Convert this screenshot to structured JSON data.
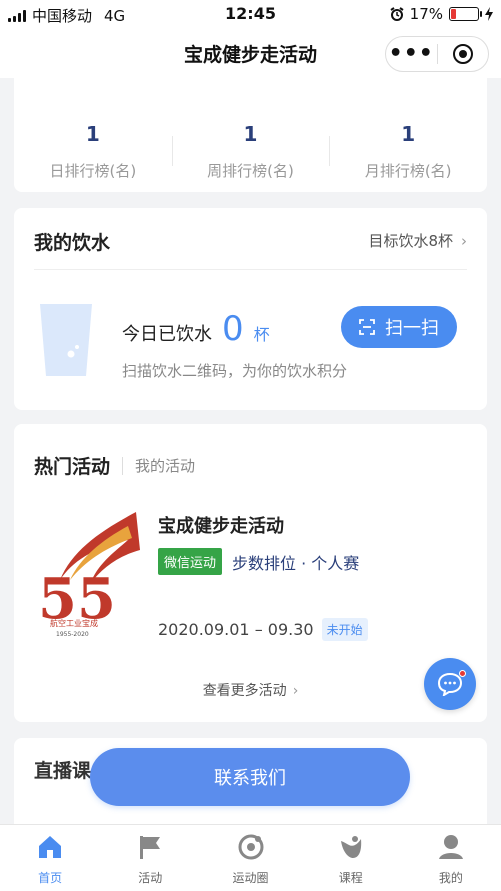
{
  "status_bar": {
    "carrier": "中国移动",
    "network": "4G",
    "time": "12:45",
    "battery": "17%",
    "battery_level": 0.17
  },
  "nav": {
    "title": "宝成健步走活动",
    "more_icon": "more-dots-icon",
    "close_icon": "target-circle-icon"
  },
  "ranking": {
    "items": [
      {
        "value": "1",
        "label": "日排行榜(名)"
      },
      {
        "value": "1",
        "label": "周排行榜(名)"
      },
      {
        "value": "1",
        "label": "月排行榜(名)"
      }
    ]
  },
  "water": {
    "title": "我的饮水",
    "goal": "目标饮水8杯",
    "today_label": "今日已饮水",
    "today_count": "0",
    "unit": "杯",
    "hint": "扫描饮水二维码，为你的饮水积分",
    "scan_label": "扫一扫"
  },
  "activities": {
    "tab_hot": "热门活动",
    "tab_mine": "我的活动",
    "item": {
      "name": "宝成健步走活动",
      "source_tag": "微信运动",
      "type": "步数排位 · 个人赛",
      "date": "2020.09.01 – 09.30",
      "status": "未开始",
      "logo_text": "航空工业宝成",
      "logo_years": "1955-2020"
    },
    "more_label": "查看更多活动"
  },
  "live": {
    "title": "直播课"
  },
  "contact_label": "联系我们",
  "tabbar": {
    "items": [
      {
        "label": "首页",
        "icon": "home-icon",
        "active": true
      },
      {
        "label": "活动",
        "icon": "flag-icon",
        "active": false
      },
      {
        "label": "运动圈",
        "icon": "circle-icon",
        "active": false
      },
      {
        "label": "课程",
        "icon": "course-icon",
        "active": false
      },
      {
        "label": "我的",
        "icon": "user-icon",
        "active": false
      }
    ]
  },
  "colors": {
    "accent": "#4a8cf0",
    "green_tag": "#35a447",
    "rank_number": "#2a3f7a"
  }
}
